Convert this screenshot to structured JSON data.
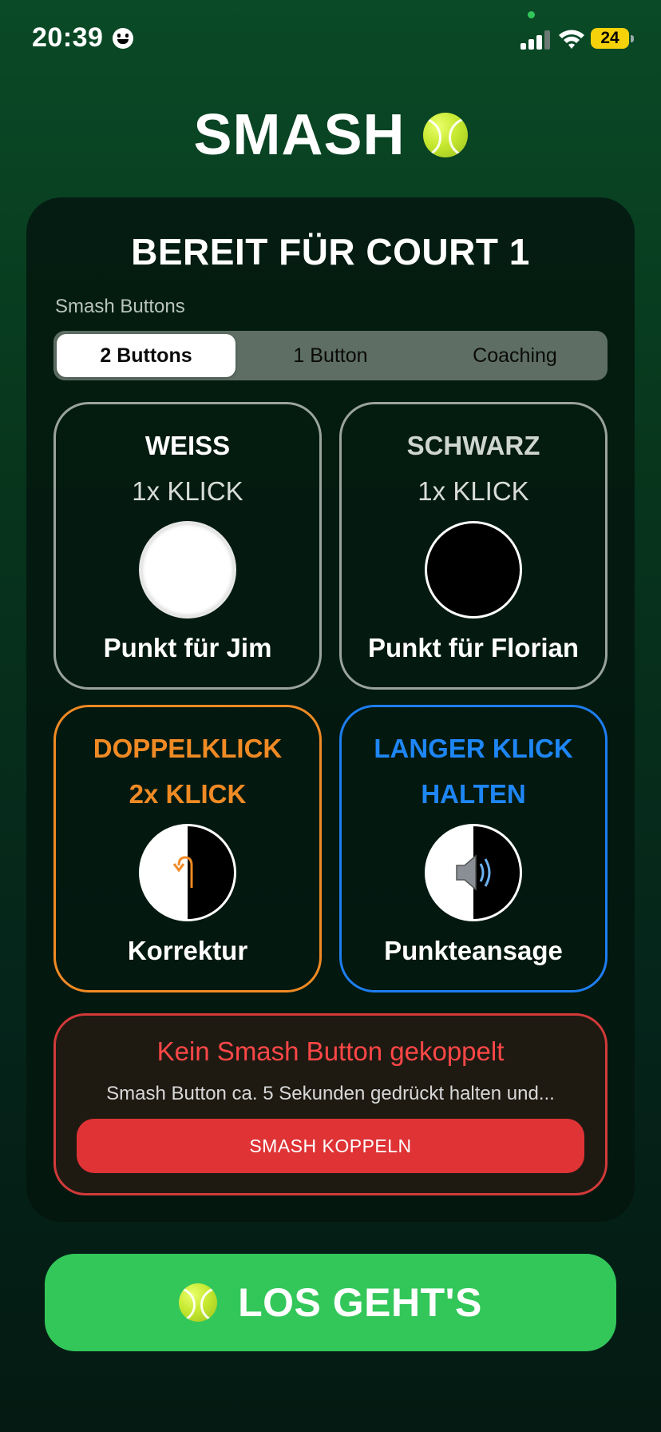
{
  "status_bar": {
    "time": "20:39",
    "battery": "24"
  },
  "app": {
    "title": "SMASH"
  },
  "card": {
    "title": "BEREIT FÜR COURT 1",
    "section_label": "Smash Buttons",
    "segments": [
      {
        "label": "2 Buttons",
        "selected": true
      },
      {
        "label": "1 Button",
        "selected": false
      },
      {
        "label": "Coaching",
        "selected": false
      }
    ],
    "tiles": [
      {
        "head": "WEISS",
        "sub": "1x KLICK",
        "action": "Punkt für Jim",
        "color": "#9aa39e"
      },
      {
        "head": "SCHWARZ",
        "sub": "1x KLICK",
        "action": "Punkt für Florian",
        "color": "#9aa39e"
      },
      {
        "head": "DOPPELKLICK",
        "sub": "2x KLICK",
        "action": "Korrektur",
        "color": "#f08a24",
        "icon": "undo-arrow-icon"
      },
      {
        "head": "LANGER KLICK",
        "sub": "HALTEN",
        "action": "Punkteansage",
        "color": "#1e7ef0",
        "icon": "speaker-icon"
      }
    ],
    "pairing": {
      "title": "Kein Smash Button gekoppelt",
      "description": "Smash Button ca. 5 Sekunden gedrückt halten und...",
      "button": "SMASH KOPPELN"
    }
  },
  "start_button": {
    "label": "LOS GEHT'S",
    "icon": "tennis-ball-icon"
  }
}
